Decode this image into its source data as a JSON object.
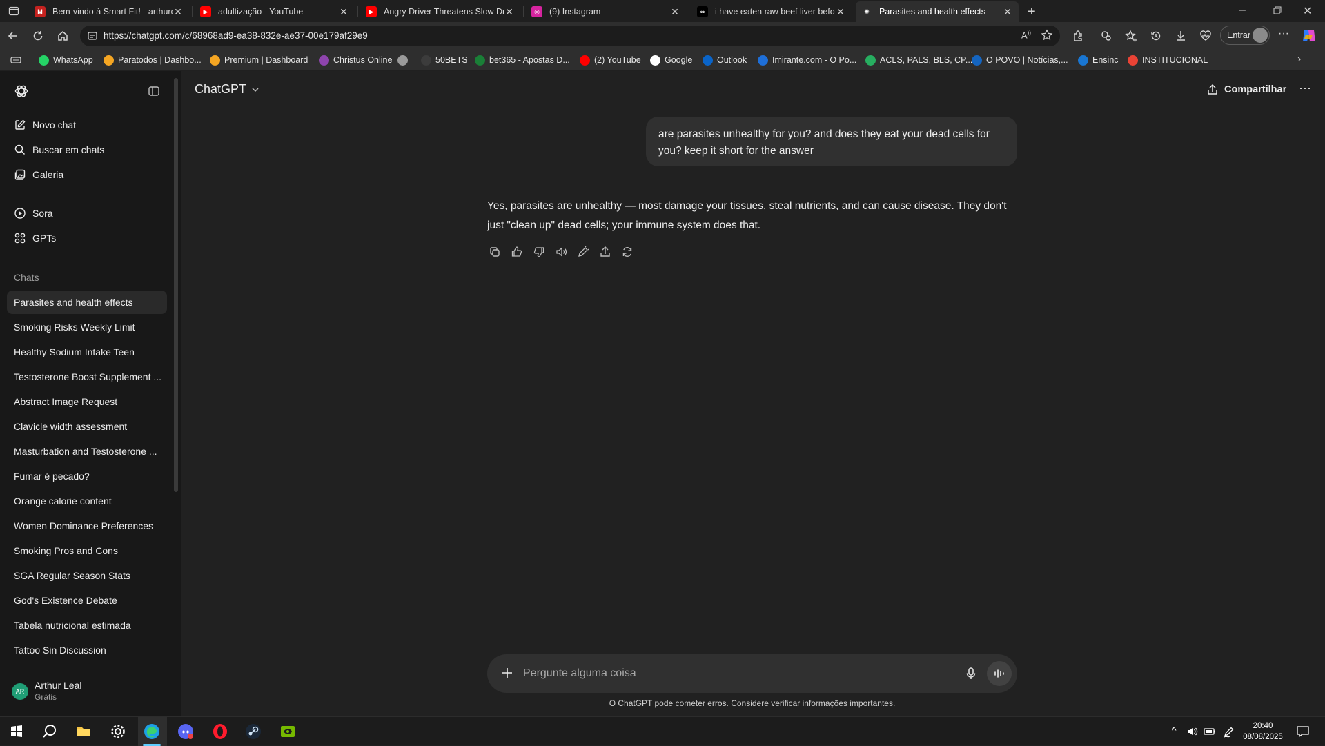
{
  "browser": {
    "tabs": [
      {
        "title": "Bem-vindo à Smart Fit! - arthurca",
        "icon": "gmail-icon",
        "color": "#c5221f",
        "glyph": "M"
      },
      {
        "title": "adultização - YouTube",
        "icon": "youtube-icon",
        "color": "#ff0000",
        "glyph": "▶"
      },
      {
        "title": "Angry Driver Threatens Slow Driv",
        "icon": "youtube-icon",
        "color": "#ff0000",
        "glyph": "▶"
      },
      {
        "title": "(9) Instagram",
        "icon": "instagram-icon",
        "color": "#d6249f",
        "glyph": "◎"
      },
      {
        "title": "i have eaten raw beef liver before",
        "icon": "meta-ai-icon",
        "color": "#000000",
        "glyph": "∞"
      },
      {
        "title": "Parasites and health effects",
        "icon": "chatgpt-icon",
        "color": "#2e2e2e",
        "glyph": "✺"
      }
    ],
    "url": "https://chatgpt.com/c/68968ad9-ea38-832e-ae37-00e179af29e9",
    "signin_label": "Entrar",
    "bookmarks": [
      {
        "label": "WhatsApp",
        "color": "#25d366"
      },
      {
        "label": "Paratodos | Dashbo...",
        "color": "#f5a623"
      },
      {
        "label": "Premium | Dashboard",
        "color": "#f5a623"
      },
      {
        "label": "Christus Online",
        "color": "#8e44ad"
      },
      {
        "label": "",
        "color": "#9a9a9a"
      },
      {
        "label": "50BETS",
        "color": "#3c3c3c"
      },
      {
        "label": "bet365 - Apostas D...",
        "color": "#1a7f37"
      },
      {
        "label": "(2) YouTube",
        "color": "#ff0000"
      },
      {
        "label": "Google",
        "color": "#ffffff"
      },
      {
        "label": "Outlook",
        "color": "#0a64c8"
      },
      {
        "label": "Imirante.com - O Po...",
        "color": "#1e6fd9"
      },
      {
        "label": "ACLS, PALS, BLS, CP...",
        "color": "#27ae60"
      },
      {
        "label": "O POVO | Notícias,...",
        "color": "#1565c0"
      },
      {
        "label": "Ensinc",
        "color": "#1976d2"
      },
      {
        "label": "INSTITUCIONAL",
        "color": "#ea4335"
      }
    ]
  },
  "app": {
    "model_label": "ChatGPT",
    "share_label": "Compartilhar",
    "nav": {
      "new_chat": "Novo chat",
      "search": "Buscar em chats",
      "gallery": "Galeria",
      "sora": "Sora",
      "gpts": "GPTs"
    },
    "chats_heading": "Chats",
    "chats": [
      "Parasites and health effects",
      "Smoking Risks Weekly Limit",
      "Healthy Sodium Intake Teen",
      "Testosterone Boost Supplement ...",
      "Abstract Image Request",
      "Clavicle width assessment",
      "Masturbation and Testosterone ...",
      "Fumar é pecado?",
      "Orange calorie content",
      "Women Dominance Preferences",
      "Smoking Pros and Cons",
      "SGA Regular Season Stats",
      "God's Existence Debate",
      "Tabela nutricional estimada",
      "Tattoo Sin Discussion"
    ],
    "user": {
      "initials": "AR",
      "name": "Arthur Leal",
      "plan": "Grátis"
    },
    "conversation": {
      "user_message": "are parasites unhealthy for you? and does they eat your dead cells for you? keep it short for the answer",
      "assistant_message": "Yes, parasites are unhealthy — most damage your tissues, steal nutrients, and can cause disease. They don't just \"clean up\" dead cells; your immune system does that."
    },
    "composer_placeholder": "Pergunte alguma coisa",
    "disclaimer": "O ChatGPT pode cometer erros. Considere verificar informações importantes."
  },
  "taskbar": {
    "time": "20:40",
    "date": "08/08/2025"
  }
}
